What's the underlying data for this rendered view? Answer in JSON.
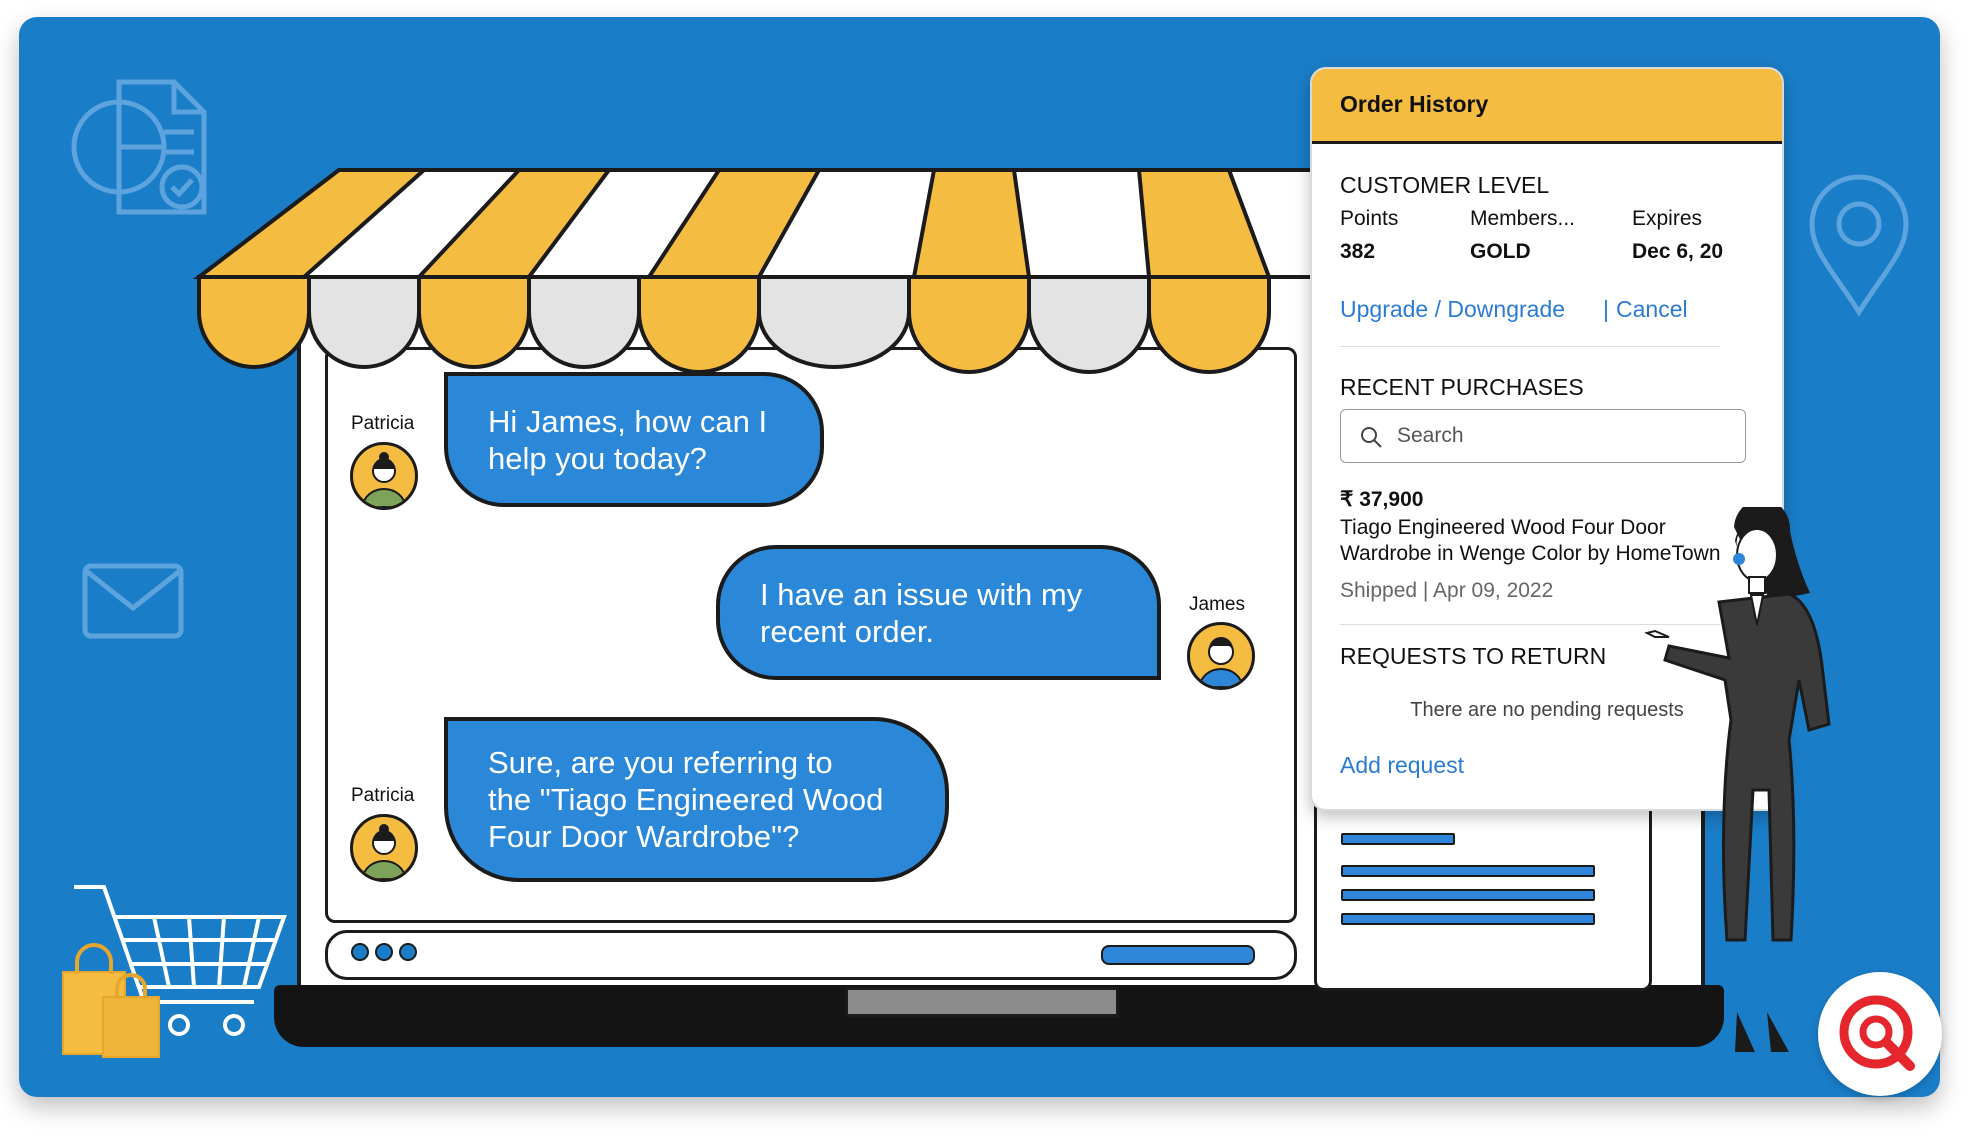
{
  "chat": {
    "messages": [
      {
        "sender": "Patricia",
        "text": "Hi James, how can I\nhelp you today?"
      },
      {
        "sender": "James",
        "text": "I have an issue with my\nrecent order."
      },
      {
        "sender": "Patricia",
        "text": "Sure, are you referring to\nthe \"Tiago Engineered Wood\nFour Door Wardrobe\"?"
      }
    ]
  },
  "order_history": {
    "title": "Order History",
    "customer_level": {
      "heading": "CUSTOMER LEVEL",
      "points_label": "Points",
      "points_value": "382",
      "membership_label": "Members...",
      "membership_value": "GOLD",
      "expires_label": "Expires",
      "expires_value": "Dec 6, 20"
    },
    "actions": {
      "upgrade": "Upgrade / Downgrade",
      "separator": "|",
      "cancel": "Cancel"
    },
    "recent_purchases": {
      "heading": "RECENT PURCHASES",
      "search_placeholder": "Search",
      "price": "₹ 37,900",
      "product": "Tiago Engineered Wood Four Door Wardrobe in Wenge Color by HomeTown",
      "status": "Shipped | Apr 09, 2022"
    },
    "returns": {
      "heading": "REQUESTS TO RETURN",
      "empty_text": "There are no pending requests",
      "add_link": "Add request"
    }
  },
  "colors": {
    "background": "#1a7dc7",
    "bubble": "#2b87d8",
    "awning_yellow": "#f5bc42",
    "link": "#2b7bd3"
  },
  "icons": [
    "report-icon",
    "location-pin-icon",
    "mail-icon",
    "shopping-cart-icon",
    "shopping-bags-icon",
    "search-icon",
    "brand-logo-icon"
  ]
}
